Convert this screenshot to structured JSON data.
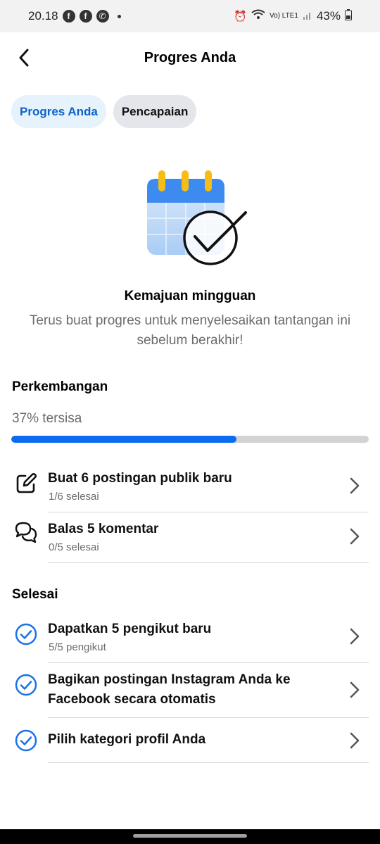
{
  "status_bar": {
    "time": "20.18",
    "notif_icons": [
      "facebook-icon",
      "facebook-icon",
      "whatsapp-icon"
    ],
    "network": "Vo) LTE1",
    "battery": "43%"
  },
  "header": {
    "title": "Progres Anda"
  },
  "tabs": [
    {
      "label": "Progres Anda",
      "active": true
    },
    {
      "label": "Pencapaian",
      "active": false
    }
  ],
  "hero": {
    "illustration": "calendar-check-icon",
    "title": "Kemajuan mingguan",
    "description": "Terus buat progres untuk menyelesaikan tantangan ini sebelum berakhir!"
  },
  "progress": {
    "section_title": "Perkembangan",
    "remaining_label": "37% tersisa",
    "fill_percent": 63
  },
  "tasks": [
    {
      "icon": "edit-icon",
      "title": "Buat 6 postingan publik baru",
      "subtitle": "1/6 selesai"
    },
    {
      "icon": "chat-bubbles-icon",
      "title": "Balas 5 komentar",
      "subtitle": "0/5 selesai"
    }
  ],
  "completed": {
    "section_title": "Selesai",
    "items": [
      {
        "icon": "check-circle-icon",
        "title": "Dapatkan 5 pengikut baru",
        "subtitle": "5/5 pengikut"
      },
      {
        "icon": "check-circle-icon",
        "title": "Bagikan postingan Instagram Anda ke Facebook secara otomatis",
        "subtitle": ""
      },
      {
        "icon": "check-circle-icon",
        "title": "Pilih kategori profil Anda",
        "subtitle": ""
      }
    ]
  },
  "colors": {
    "accent": "#0b6cf2",
    "tab_active_bg": "#e6f2fc",
    "tab_active_text": "#0b63c9",
    "tab_inactive_bg": "#e5e6eb",
    "check": "#1a73e8"
  }
}
